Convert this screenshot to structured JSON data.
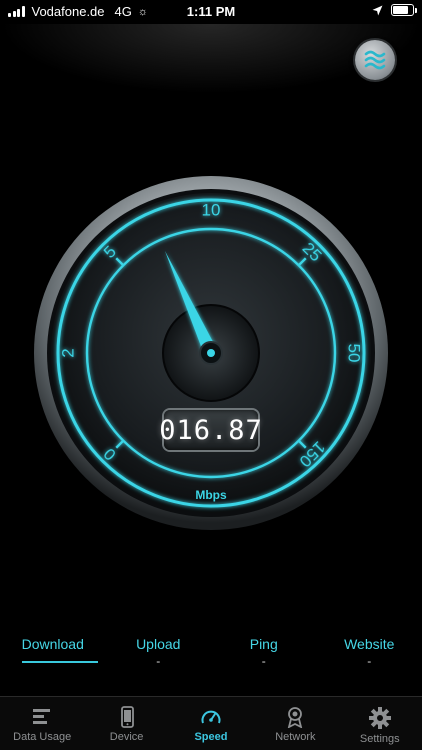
{
  "status_bar": {
    "carrier": "Vodafone.de",
    "network": "4G",
    "activity_glyph": "☼",
    "time": "1:11 PM",
    "icons": [
      "signal-icon",
      "location-arrow-icon",
      "battery-icon"
    ]
  },
  "theme_button": {
    "icon": "waves-icon"
  },
  "gauge": {
    "scale_labels": [
      "0",
      "2",
      "5",
      "10",
      "25",
      "50",
      "150"
    ],
    "needle_fraction": 0.41,
    "reading": "016.87",
    "unit": "Mbps",
    "accent_color": "#3ad5e6"
  },
  "modes": [
    {
      "label": "Download",
      "value": "",
      "active": true
    },
    {
      "label": "Upload",
      "value": "-",
      "active": false
    },
    {
      "label": "Ping",
      "value": "-",
      "active": false
    },
    {
      "label": "Website",
      "value": "-",
      "active": false
    }
  ],
  "tabs": [
    {
      "label": "Data Usage",
      "icon": "data-usage-icon",
      "active": false
    },
    {
      "label": "Device",
      "icon": "phone-icon",
      "active": false
    },
    {
      "label": "Speed",
      "icon": "speedometer-icon",
      "active": true
    },
    {
      "label": "Network",
      "icon": "network-icon",
      "active": false
    },
    {
      "label": "Settings",
      "icon": "gear-icon",
      "active": false
    }
  ]
}
